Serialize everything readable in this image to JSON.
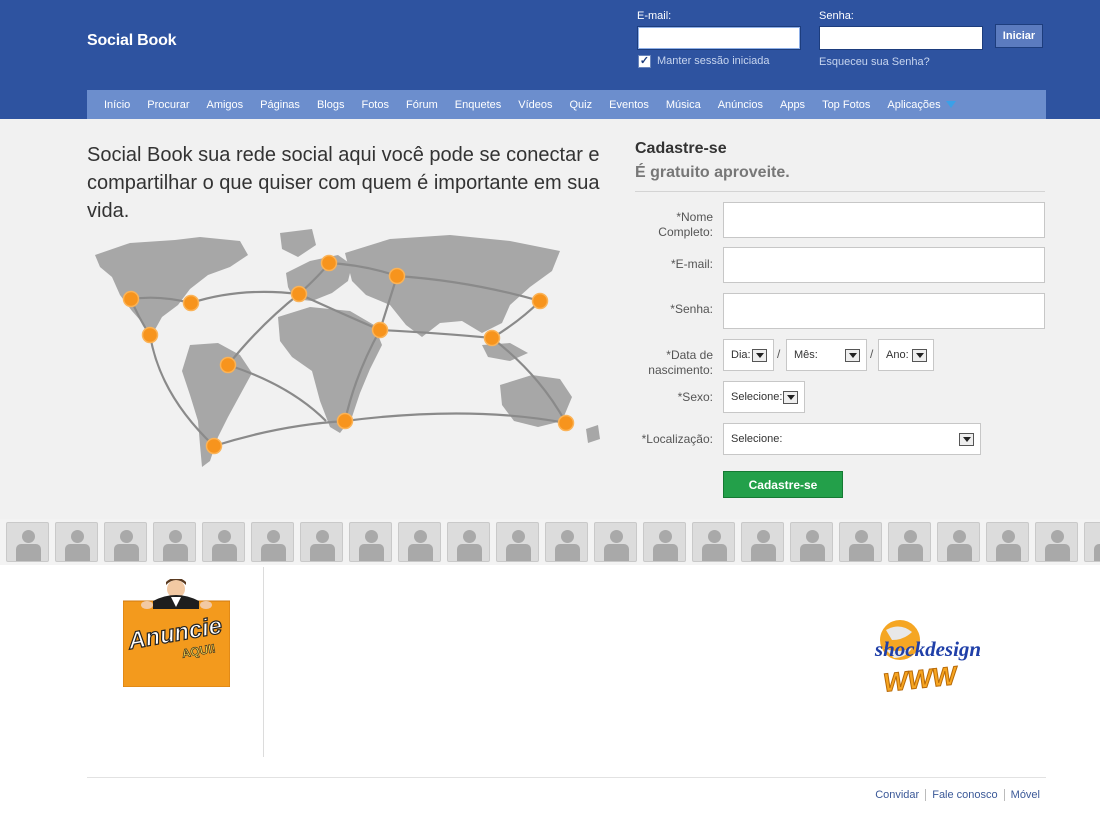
{
  "brand": "Social Book",
  "login": {
    "email_label": "E-mail:",
    "password_label": "Senha:",
    "submit_label": "Iniciar",
    "remember_label": "Manter sessão iniciada",
    "forgot_label": "Esqueceu sua Senha?"
  },
  "nav": {
    "items": [
      "Início",
      "Procurar",
      "Amigos",
      "Páginas",
      "Blogs",
      "Fotos",
      "Fórum",
      "Enquetes",
      "Vídeos",
      "Quiz",
      "Eventos",
      "Música",
      "Anúncios",
      "Apps",
      "Top Fotos",
      "Aplicações"
    ],
    "more_arrow_icon": "triangle-down-icon"
  },
  "headline": "Social Book sua rede social aqui você pode se conectar e compartilhar o que quiser com quem é importante em sua vida.",
  "signup": {
    "title": "Cadastre-se",
    "subtitle": "É gratuito aproveite.",
    "fields": {
      "name_label": "*Nome Completo:",
      "email_label": "*E-mail:",
      "password_label": "*Senha:",
      "birth_label": "*Data de nascimento:",
      "sex_label": "*Sexo:",
      "location_label": "*Localização:"
    },
    "birth": {
      "day": "Dia:",
      "month": "Mês:",
      "year": "Ano:",
      "separator": "/"
    },
    "sex_select": "Selecione:",
    "location_select": "Selecione:",
    "submit_label": "Cadastre-se"
  },
  "ad": {
    "line1": "Anuncie",
    "line2": "AQUI!"
  },
  "sponsor": {
    "name": "shockdesign",
    "tag": "WWW"
  },
  "footer": {
    "links": [
      "Convidar",
      "Fale conosco",
      "Móvel"
    ]
  },
  "colors": {
    "header_bg": "#2e53a0",
    "nav_bg": "#6c8ecd",
    "node_orange": "#f7941d",
    "signup_green": "#23a04a",
    "link_blue": "#3b5998"
  }
}
